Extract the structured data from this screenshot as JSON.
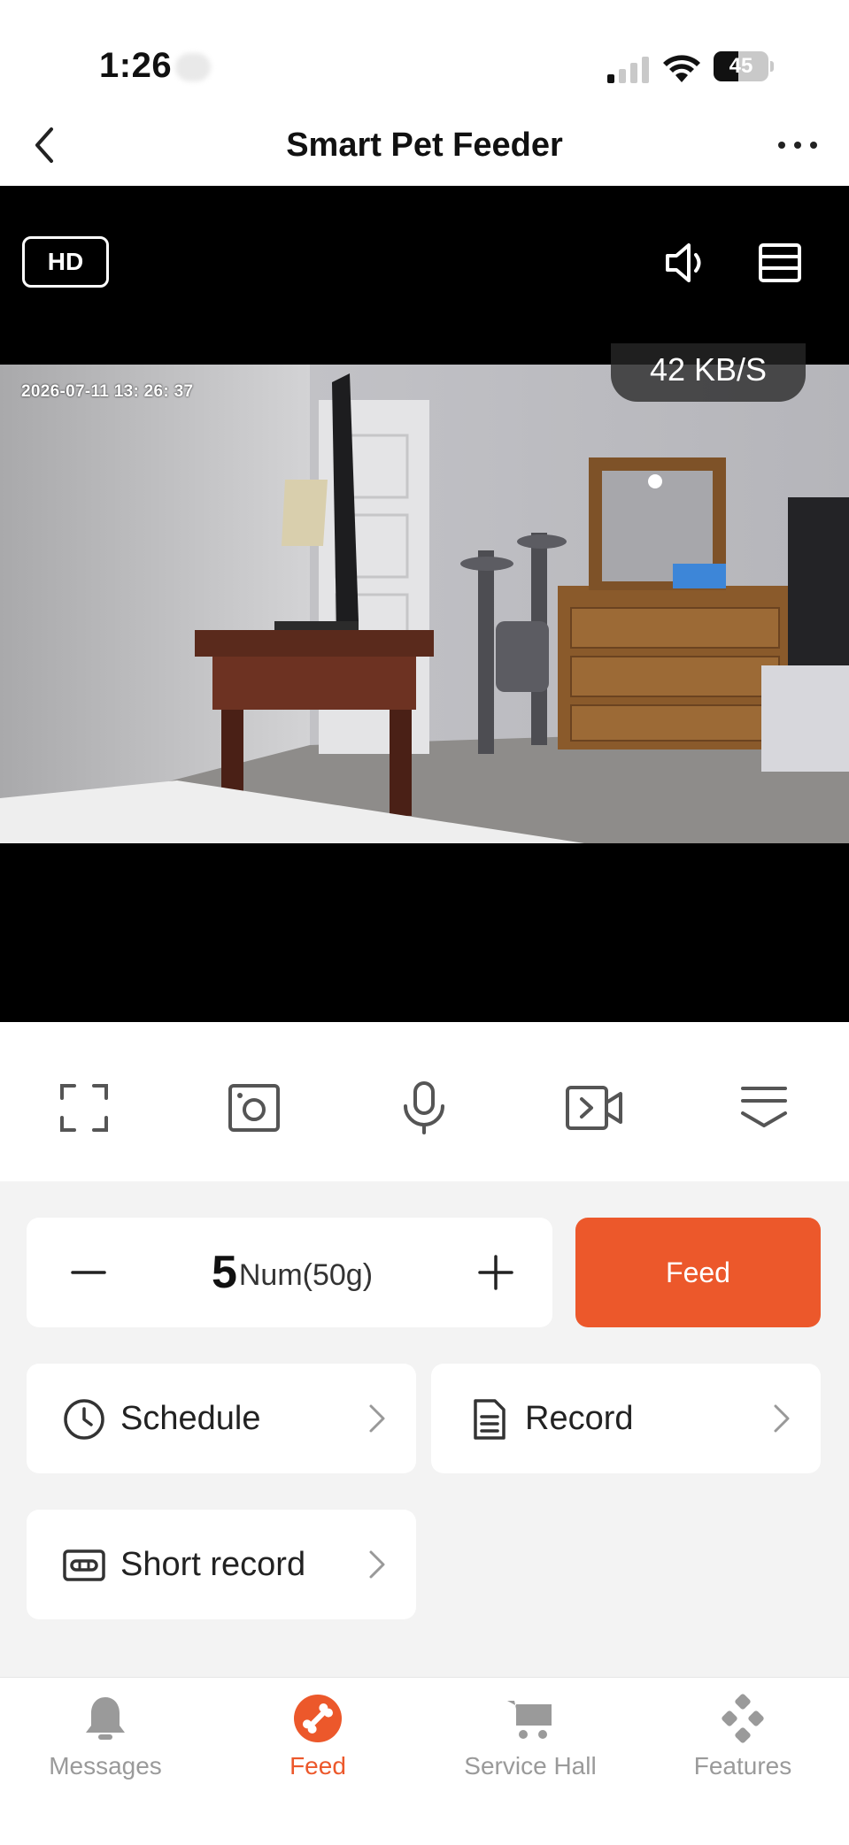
{
  "status_bar": {
    "time": "1:26",
    "battery": "45",
    "battery_level": 0.45
  },
  "header": {
    "title": "Smart Pet Feeder"
  },
  "video": {
    "quality_label": "HD",
    "speed": "42 KB/S",
    "timestamp": "2026-07-11  13: 26: 37"
  },
  "controls": {
    "icons": [
      "fullscreen-icon",
      "screenshot-icon",
      "microphone-icon",
      "video-record-icon",
      "collapse-menu-icon"
    ]
  },
  "feeding": {
    "quantity": "5",
    "unit": "Num(50g)",
    "feed_label": "Feed"
  },
  "nav_cards": {
    "schedule": "Schedule",
    "record": "Record",
    "short_record": "Short record"
  },
  "tabbar": {
    "messages": "Messages",
    "feed": "Feed",
    "service_hall": "Service Hall",
    "features": "Features",
    "active": "Feed"
  },
  "colors": {
    "accent": "#ec582b",
    "inactive": "#9a9a9a",
    "background": "#f3f3f3"
  }
}
